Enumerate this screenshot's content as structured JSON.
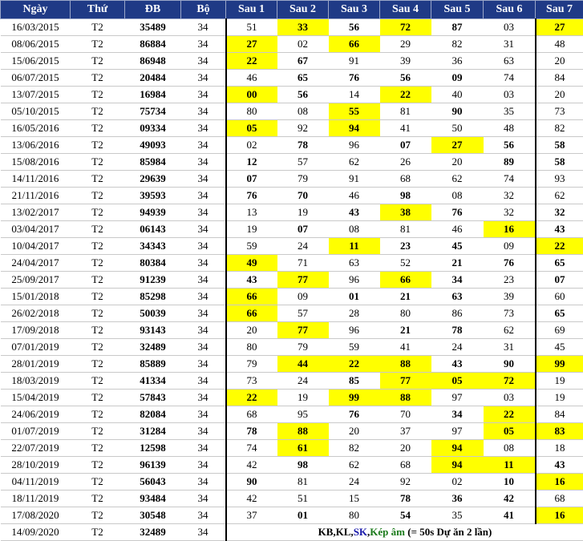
{
  "headers": [
    "Ngày",
    "Thứ",
    "ĐB",
    "Bộ",
    "Sau 1",
    "Sau 2",
    "Sau 3",
    "Sau 4",
    "Sau 5",
    "Sau 6",
    "Sau 7"
  ],
  "colors": {
    "header_bg": "#1f3a86",
    "highlight": "#ffff00",
    "red": "#e02020",
    "blue": "#1a1aaa",
    "green": "#1b7a1b"
  },
  "rows": [
    {
      "date": "16/03/2015",
      "thu": "T2",
      "db": "35489",
      "bo": "34",
      "sau": [
        {
          "v": "51",
          "c": "k"
        },
        {
          "v": "33",
          "c": "y"
        },
        {
          "v": "56",
          "c": "b"
        },
        {
          "v": "72",
          "c": "y"
        },
        {
          "v": "87",
          "c": "b"
        },
        {
          "v": "03",
          "c": "k"
        },
        {
          "v": "27",
          "c": "y"
        }
      ]
    },
    {
      "date": "08/06/2015",
      "thu": "T2",
      "db": "86884",
      "bo": "34",
      "sau": [
        {
          "v": "27",
          "c": "y"
        },
        {
          "v": "02",
          "c": "k"
        },
        {
          "v": "66",
          "c": "y"
        },
        {
          "v": "29",
          "c": "k"
        },
        {
          "v": "82",
          "c": "k"
        },
        {
          "v": "31",
          "c": "k"
        },
        {
          "v": "48",
          "c": "k"
        }
      ]
    },
    {
      "date": "15/06/2015",
      "thu": "T2",
      "db": "86948",
      "bo": "34",
      "sau": [
        {
          "v": "22",
          "c": "y"
        },
        {
          "v": "67",
          "c": "b"
        },
        {
          "v": "91",
          "c": "k"
        },
        {
          "v": "39",
          "c": "k"
        },
        {
          "v": "36",
          "c": "k"
        },
        {
          "v": "63",
          "c": "k"
        },
        {
          "v": "20",
          "c": "k"
        }
      ]
    },
    {
      "date": "06/07/2015",
      "thu": "T2",
      "db": "20484",
      "bo": "34",
      "sau": [
        {
          "v": "46",
          "c": "k"
        },
        {
          "v": "65",
          "c": "b"
        },
        {
          "v": "76",
          "c": "b"
        },
        {
          "v": "56",
          "c": "b"
        },
        {
          "v": "09",
          "c": "g"
        },
        {
          "v": "74",
          "c": "k"
        },
        {
          "v": "84",
          "c": "k"
        }
      ]
    },
    {
      "date": "13/07/2015",
      "thu": "T2",
      "db": "16984",
      "bo": "34",
      "sau": [
        {
          "v": "00",
          "c": "y"
        },
        {
          "v": "56",
          "c": "b"
        },
        {
          "v": "14",
          "c": "k"
        },
        {
          "v": "22",
          "c": "y"
        },
        {
          "v": "40",
          "c": "k"
        },
        {
          "v": "03",
          "c": "k"
        },
        {
          "v": "20",
          "c": "k"
        }
      ]
    },
    {
      "date": "05/10/2015",
      "thu": "T2",
      "db": "75734",
      "bo": "34",
      "sau": [
        {
          "v": "80",
          "c": "k"
        },
        {
          "v": "08",
          "c": "k"
        },
        {
          "v": "55",
          "c": "y"
        },
        {
          "v": "81",
          "c": "k"
        },
        {
          "v": "90",
          "c": "g"
        },
        {
          "v": "35",
          "c": "k"
        },
        {
          "v": "73",
          "c": "k"
        }
      ]
    },
    {
      "date": "16/05/2016",
      "thu": "T2",
      "db": "09334",
      "bo": "34",
      "sau": [
        {
          "v": "05",
          "c": "y"
        },
        {
          "v": "92",
          "c": "k"
        },
        {
          "v": "94",
          "c": "y"
        },
        {
          "v": "41",
          "c": "k"
        },
        {
          "v": "50",
          "c": "k"
        },
        {
          "v": "48",
          "c": "k"
        },
        {
          "v": "82",
          "c": "k"
        }
      ]
    },
    {
      "date": "13/06/2016",
      "thu": "T2",
      "db": "49093",
      "bo": "34",
      "sau": [
        {
          "v": "02",
          "c": "k"
        },
        {
          "v": "78",
          "c": "b"
        },
        {
          "v": "96",
          "c": "k"
        },
        {
          "v": "07",
          "c": "g"
        },
        {
          "v": "27",
          "c": "y"
        },
        {
          "v": "56",
          "c": "b"
        },
        {
          "v": "58",
          "c": "g"
        }
      ]
    },
    {
      "date": "15/08/2016",
      "thu": "T2",
      "db": "85984",
      "bo": "34",
      "sau": [
        {
          "v": "12",
          "c": "b"
        },
        {
          "v": "57",
          "c": "k"
        },
        {
          "v": "62",
          "c": "k"
        },
        {
          "v": "26",
          "c": "k"
        },
        {
          "v": "20",
          "c": "k"
        },
        {
          "v": "89",
          "c": "b"
        },
        {
          "v": "58",
          "c": "g"
        }
      ]
    },
    {
      "date": "14/11/2016",
      "thu": "T2",
      "db": "29639",
      "bo": "34",
      "sau": [
        {
          "v": "07",
          "c": "g"
        },
        {
          "v": "79",
          "c": "k"
        },
        {
          "v": "91",
          "c": "k"
        },
        {
          "v": "68",
          "c": "k"
        },
        {
          "v": "62",
          "c": "k"
        },
        {
          "v": "74",
          "c": "k"
        },
        {
          "v": "93",
          "c": "k"
        }
      ]
    },
    {
      "date": "21/11/2016",
      "thu": "T2",
      "db": "39593",
      "bo": "34",
      "sau": [
        {
          "v": "76",
          "c": "b"
        },
        {
          "v": "70",
          "c": "g"
        },
        {
          "v": "46",
          "c": "k"
        },
        {
          "v": "98",
          "c": "b"
        },
        {
          "v": "08",
          "c": "k"
        },
        {
          "v": "32",
          "c": "k"
        },
        {
          "v": "62",
          "c": "k"
        }
      ]
    },
    {
      "date": "13/02/2017",
      "thu": "T2",
      "db": "94939",
      "bo": "34",
      "sau": [
        {
          "v": "13",
          "c": "k"
        },
        {
          "v": "19",
          "c": "k"
        },
        {
          "v": "43",
          "c": "b"
        },
        {
          "v": "38",
          "c": "y"
        },
        {
          "v": "76",
          "c": "b"
        },
        {
          "v": "32",
          "c": "k"
        },
        {
          "v": "32",
          "c": "b"
        }
      ]
    },
    {
      "date": "03/04/2017",
      "thu": "T2",
      "db": "06143",
      "bo": "34",
      "sau": [
        {
          "v": "19",
          "c": "k"
        },
        {
          "v": "07",
          "c": "g"
        },
        {
          "v": "08",
          "c": "k"
        },
        {
          "v": "81",
          "c": "k"
        },
        {
          "v": "46",
          "c": "k"
        },
        {
          "v": "16",
          "c": "y"
        },
        {
          "v": "43",
          "c": "b"
        }
      ]
    },
    {
      "date": "10/04/2017",
      "thu": "T2",
      "db": "34343",
      "bo": "34",
      "sau": [
        {
          "v": "59",
          "c": "k"
        },
        {
          "v": "24",
          "c": "k"
        },
        {
          "v": "11",
          "c": "y"
        },
        {
          "v": "23",
          "c": "b"
        },
        {
          "v": "45",
          "c": "b"
        },
        {
          "v": "09",
          "c": "k"
        },
        {
          "v": "22",
          "c": "y"
        }
      ]
    },
    {
      "date": "24/04/2017",
      "thu": "T2",
      "db": "80384",
      "bo": "34",
      "sau": [
        {
          "v": "49",
          "c": "y"
        },
        {
          "v": "71",
          "c": "k"
        },
        {
          "v": "63",
          "c": "k"
        },
        {
          "v": "52",
          "c": "k"
        },
        {
          "v": "21",
          "c": "b"
        },
        {
          "v": "76",
          "c": "b"
        },
        {
          "v": "65",
          "c": "b"
        }
      ]
    },
    {
      "date": "25/09/2017",
      "thu": "T2",
      "db": "91239",
      "bo": "34",
      "sau": [
        {
          "v": "43",
          "c": "b"
        },
        {
          "v": "77",
          "c": "y"
        },
        {
          "v": "96",
          "c": "k"
        },
        {
          "v": "66",
          "c": "y"
        },
        {
          "v": "34",
          "c": "b"
        },
        {
          "v": "23",
          "c": "k"
        },
        {
          "v": "07",
          "c": "g"
        }
      ]
    },
    {
      "date": "15/01/2018",
      "thu": "T2",
      "db": "85298",
      "bo": "34",
      "sau": [
        {
          "v": "66",
          "c": "y"
        },
        {
          "v": "09",
          "c": "k"
        },
        {
          "v": "01",
          "c": "b"
        },
        {
          "v": "21",
          "c": "b"
        },
        {
          "v": "63",
          "c": "g"
        },
        {
          "v": "39",
          "c": "k"
        },
        {
          "v": "60",
          "c": "k"
        }
      ]
    },
    {
      "date": "26/02/2018",
      "thu": "T2",
      "db": "50039",
      "bo": "34",
      "sau": [
        {
          "v": "66",
          "c": "y"
        },
        {
          "v": "57",
          "c": "k"
        },
        {
          "v": "28",
          "c": "k"
        },
        {
          "v": "80",
          "c": "k"
        },
        {
          "v": "86",
          "c": "k"
        },
        {
          "v": "73",
          "c": "k"
        },
        {
          "v": "65",
          "c": "b"
        }
      ]
    },
    {
      "date": "17/09/2018",
      "thu": "T2",
      "db": "93143",
      "bo": "34",
      "sau": [
        {
          "v": "20",
          "c": "k"
        },
        {
          "v": "77",
          "c": "y"
        },
        {
          "v": "96",
          "c": "k"
        },
        {
          "v": "21",
          "c": "b"
        },
        {
          "v": "78",
          "c": "b"
        },
        {
          "v": "62",
          "c": "k"
        },
        {
          "v": "69",
          "c": "k"
        }
      ]
    },
    {
      "date": "07/01/2019",
      "thu": "T2",
      "db": "32489",
      "bo": "34",
      "sau": [
        {
          "v": "80",
          "c": "k"
        },
        {
          "v": "79",
          "c": "k"
        },
        {
          "v": "59",
          "c": "k"
        },
        {
          "v": "41",
          "c": "k"
        },
        {
          "v": "24",
          "c": "k"
        },
        {
          "v": "31",
          "c": "k"
        },
        {
          "v": "45",
          "c": "k"
        }
      ]
    },
    {
      "date": "28/01/2019",
      "thu": "T2",
      "db": "85889",
      "bo": "34",
      "sau": [
        {
          "v": "79",
          "c": "k"
        },
        {
          "v": "44",
          "c": "y"
        },
        {
          "v": "22",
          "c": "y"
        },
        {
          "v": "88",
          "c": "y"
        },
        {
          "v": "43",
          "c": "b"
        },
        {
          "v": "90",
          "c": "g"
        },
        {
          "v": "99",
          "c": "y"
        }
      ]
    },
    {
      "date": "18/03/2019",
      "thu": "T2",
      "db": "41334",
      "bo": "34",
      "sau": [
        {
          "v": "73",
          "c": "k"
        },
        {
          "v": "24",
          "c": "k"
        },
        {
          "v": "85",
          "c": "g"
        },
        {
          "v": "77",
          "c": "y"
        },
        {
          "v": "05",
          "c": "y"
        },
        {
          "v": "72",
          "c": "y"
        },
        {
          "v": "19",
          "c": "k"
        }
      ]
    },
    {
      "date": "15/04/2019",
      "thu": "T2",
      "db": "57843",
      "bo": "34",
      "sau": [
        {
          "v": "22",
          "c": "y"
        },
        {
          "v": "19",
          "c": "k"
        },
        {
          "v": "99",
          "c": "y"
        },
        {
          "v": "88",
          "c": "y"
        },
        {
          "v": "97",
          "c": "k"
        },
        {
          "v": "03",
          "c": "k"
        },
        {
          "v": "19",
          "c": "k"
        }
      ]
    },
    {
      "date": "24/06/2019",
      "thu": "T2",
      "db": "82084",
      "bo": "34",
      "sau": [
        {
          "v": "68",
          "c": "k"
        },
        {
          "v": "95",
          "c": "k"
        },
        {
          "v": "76",
          "c": "b"
        },
        {
          "v": "70",
          "c": "k"
        },
        {
          "v": "34",
          "c": "b"
        },
        {
          "v": "22",
          "c": "y"
        },
        {
          "v": "84",
          "c": "k"
        }
      ]
    },
    {
      "date": "01/07/2019",
      "thu": "T2",
      "db": "31284",
      "bo": "34",
      "sau": [
        {
          "v": "78",
          "c": "b"
        },
        {
          "v": "88",
          "c": "y"
        },
        {
          "v": "20",
          "c": "k"
        },
        {
          "v": "37",
          "c": "k"
        },
        {
          "v": "97",
          "c": "k"
        },
        {
          "v": "05",
          "c": "y"
        },
        {
          "v": "83",
          "c": "y"
        }
      ]
    },
    {
      "date": "22/07/2019",
      "thu": "T2",
      "db": "12598",
      "bo": "34",
      "sau": [
        {
          "v": "74",
          "c": "k"
        },
        {
          "v": "61",
          "c": "y"
        },
        {
          "v": "82",
          "c": "k"
        },
        {
          "v": "20",
          "c": "k"
        },
        {
          "v": "94",
          "c": "y"
        },
        {
          "v": "08",
          "c": "k"
        },
        {
          "v": "18",
          "c": "k"
        }
      ]
    },
    {
      "date": "28/10/2019",
      "thu": "T2",
      "db": "96139",
      "bo": "34",
      "sau": [
        {
          "v": "42",
          "c": "k"
        },
        {
          "v": "98",
          "c": "b"
        },
        {
          "v": "62",
          "c": "k"
        },
        {
          "v": "68",
          "c": "k"
        },
        {
          "v": "94",
          "c": "y"
        },
        {
          "v": "11",
          "c": "y"
        },
        {
          "v": "43",
          "c": "b"
        }
      ]
    },
    {
      "date": "04/11/2019",
      "thu": "T2",
      "db": "56043",
      "bo": "34",
      "sau": [
        {
          "v": "90",
          "c": "b"
        },
        {
          "v": "81",
          "c": "k"
        },
        {
          "v": "24",
          "c": "k"
        },
        {
          "v": "92",
          "c": "k"
        },
        {
          "v": "02",
          "c": "k"
        },
        {
          "v": "10",
          "c": "b"
        },
        {
          "v": "16",
          "c": "y"
        }
      ]
    },
    {
      "date": "18/11/2019",
      "thu": "T2",
      "db": "93484",
      "bo": "34",
      "sau": [
        {
          "v": "42",
          "c": "k"
        },
        {
          "v": "51",
          "c": "k"
        },
        {
          "v": "15",
          "c": "k"
        },
        {
          "v": "78",
          "c": "b"
        },
        {
          "v": "36",
          "c": "g"
        },
        {
          "v": "42",
          "c": "g"
        },
        {
          "v": "68",
          "c": "k"
        }
      ]
    },
    {
      "date": "17/08/2020",
      "thu": "T2",
      "db": "30548",
      "bo": "34",
      "sau": [
        {
          "v": "37",
          "c": "k"
        },
        {
          "v": "01",
          "c": "b"
        },
        {
          "v": "80",
          "c": "k"
        },
        {
          "v": "54",
          "c": "b"
        },
        {
          "v": "35",
          "c": "k"
        },
        {
          "v": "41",
          "c": "g"
        },
        {
          "v": "16",
          "c": "y"
        }
      ]
    }
  ],
  "last_row": {
    "date": "14/09/2020",
    "thu": "T2",
    "db": "32489",
    "bo": "34",
    "note": {
      "kb": "KB,KL,",
      "sk": "SK",
      "sep": ",",
      "kep": "Kép âm",
      "rest": " (= 50s Dự ăn 2 lần)"
    }
  }
}
